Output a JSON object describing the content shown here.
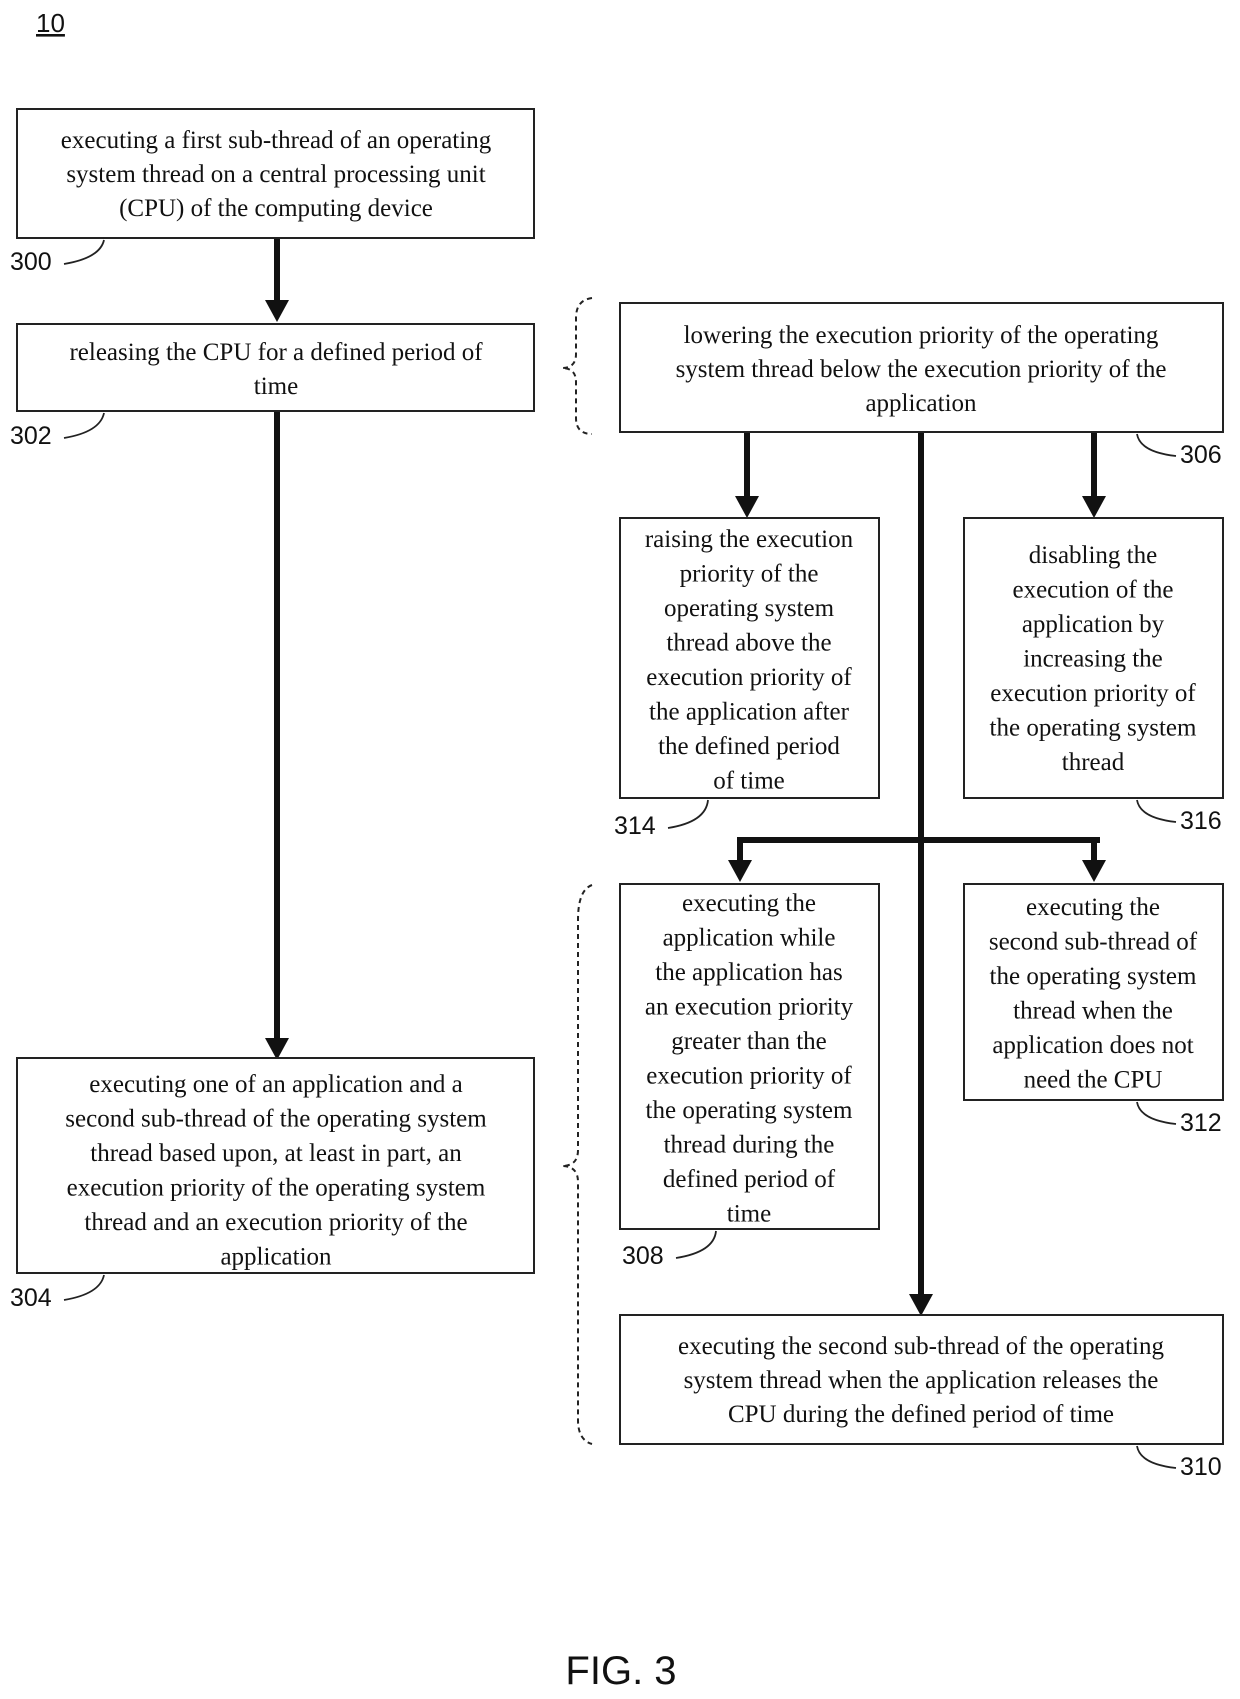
{
  "diagram_number": "10",
  "figure_label": "FIG. 3",
  "steps": {
    "s300": {
      "ref": "300",
      "lines": [
        "executing a first sub-thread of an operating",
        "system thread on a central processing unit",
        "(CPU) of the computing device"
      ]
    },
    "s302": {
      "ref": "302",
      "lines": [
        "releasing the CPU for a defined period of",
        "time"
      ]
    },
    "s304": {
      "ref": "304",
      "lines": [
        "executing one of an application and a",
        "second sub-thread of the operating system",
        "thread based upon, at least in part, an",
        "execution priority of the operating system",
        "thread and an execution priority of the",
        "application"
      ]
    },
    "s306": {
      "ref": "306",
      "lines": [
        "lowering the execution priority of the operating",
        "system thread below the execution priority of the",
        "application"
      ]
    },
    "s314": {
      "ref": "314",
      "lines": [
        "raising the execution",
        "priority of the",
        "operating system",
        "thread above the",
        "execution priority of",
        "the application after",
        "the defined period",
        "of time"
      ]
    },
    "s316": {
      "ref": "316",
      "lines": [
        "disabling the",
        "execution of the",
        "application by",
        "increasing the",
        "execution priority of",
        "the operating system",
        "thread"
      ]
    },
    "s308": {
      "ref": "308",
      "lines": [
        "executing the",
        "application while",
        "the application has",
        "an execution priority",
        "greater than the",
        "execution priority of",
        "the operating system",
        "thread during the",
        "defined period of",
        "time"
      ]
    },
    "s312": {
      "ref": "312",
      "lines": [
        "executing the",
        "second sub-thread of",
        "the operating system",
        "thread when the",
        "application does not",
        "need the CPU"
      ]
    },
    "s310": {
      "ref": "310",
      "lines": [
        "executing the second sub-thread of the operating",
        "system thread when the application releases the",
        "CPU during the defined period of time"
      ]
    }
  }
}
